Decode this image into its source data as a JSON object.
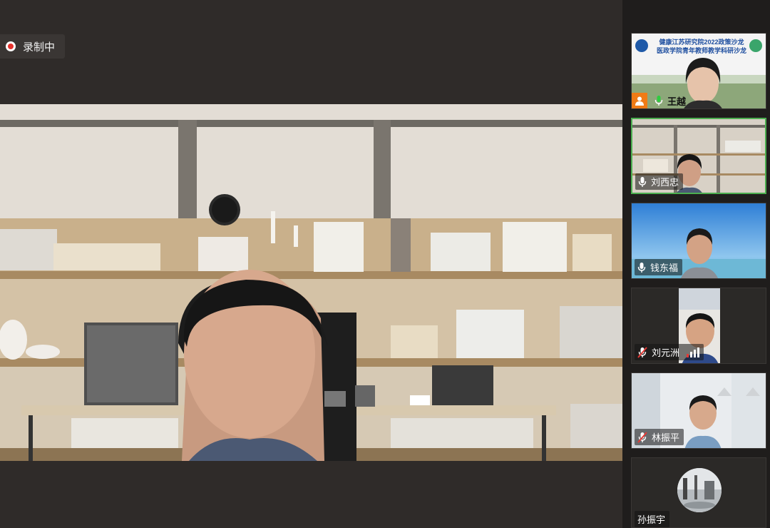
{
  "recording": {
    "label": "录制中"
  },
  "participants": [
    {
      "name": "王越",
      "banner_line1": "健康江苏研究院2022政策沙龙",
      "banner_line2": "医政学院青年教师教学科研沙龙",
      "host": true,
      "mic": "on"
    },
    {
      "name": "刘西忠",
      "mic": "on",
      "active_speaker": true
    },
    {
      "name": "钱东福",
      "mic": "on"
    },
    {
      "name": "刘元洲",
      "mic": "off"
    },
    {
      "name": "林振平",
      "mic": "off"
    },
    {
      "name": "孙振宇",
      "mic": "none"
    }
  ],
  "colors": {
    "active_border": "#4caf50",
    "host_badge": "#f07b16",
    "record_dot": "#e5322d"
  }
}
